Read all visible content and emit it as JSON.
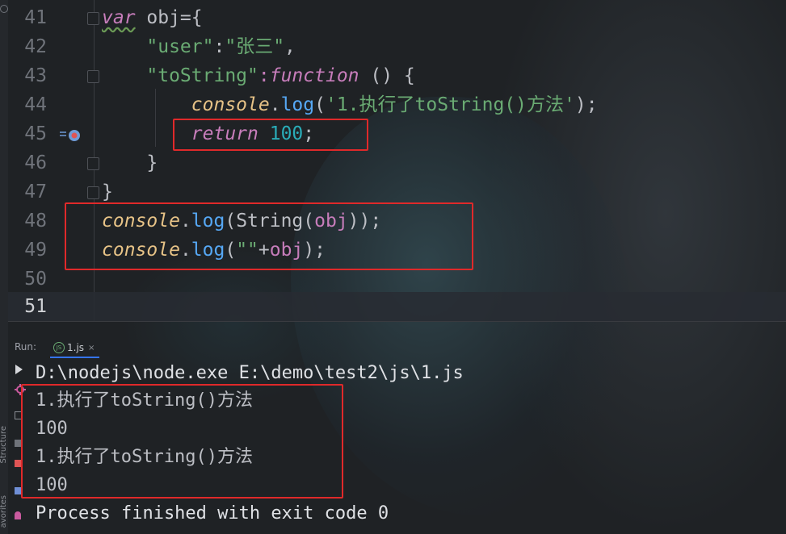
{
  "sidebar": {
    "structure_label": "Structure",
    "favorites_label": "avorites"
  },
  "editor": {
    "lines": [
      {
        "num": "41"
      },
      {
        "num": "42"
      },
      {
        "num": "43"
      },
      {
        "num": "44"
      },
      {
        "num": "45"
      },
      {
        "num": "46"
      },
      {
        "num": "47"
      },
      {
        "num": "48"
      },
      {
        "num": "49"
      },
      {
        "num": "50"
      },
      {
        "num": "51"
      }
    ],
    "code": {
      "l41_var": "var",
      "l41_rest": " obj={",
      "l42_key": "\"user\"",
      "l42_colon": ":",
      "l42_val": "\"张三\"",
      "l42_comma": ",",
      "l43_key": "\"toString\"",
      "l43_colon": ":",
      "l43_fn": "function",
      "l43_rest": " () {",
      "l44_console": "console",
      "l44_dot": ".",
      "l44_log": "log",
      "l44_open": "(",
      "l44_str": "'1.执行了toString()方法'",
      "l44_close": ");",
      "l45_return": "return",
      "l45_num": " 100",
      "l45_semi": ";",
      "l46": "}",
      "l47": "}",
      "l48_console": "console",
      "l48_dot": ".",
      "l48_log": "log",
      "l48_rest1": "(String(",
      "l48_obj": "obj",
      "l48_rest2": "));",
      "l49_console": "console",
      "l49_dot": ".",
      "l49_log": "log",
      "l49_open": "(",
      "l49_str": "\"\"",
      "l49_plus": "+",
      "l49_obj": "obj",
      "l49_close": ");"
    }
  },
  "run_panel": {
    "label": "Run:",
    "tab_label": "1.js",
    "tab_close": "×",
    "js_icon_text": "JS",
    "command": "D:\\nodejs\\node.exe E:\\demo\\test2\\js\\1.js",
    "output": [
      "1.执行了toString()方法",
      "100",
      "1.执行了toString()方法",
      "100"
    ],
    "finished": "Process finished with exit code 0"
  },
  "colors": {
    "highlight_box": "#e0292a",
    "keyword": "#c77dbb",
    "string": "#6aab73",
    "number": "#2aacb8",
    "method": "#56a8f5",
    "object": "#e7c387"
  }
}
